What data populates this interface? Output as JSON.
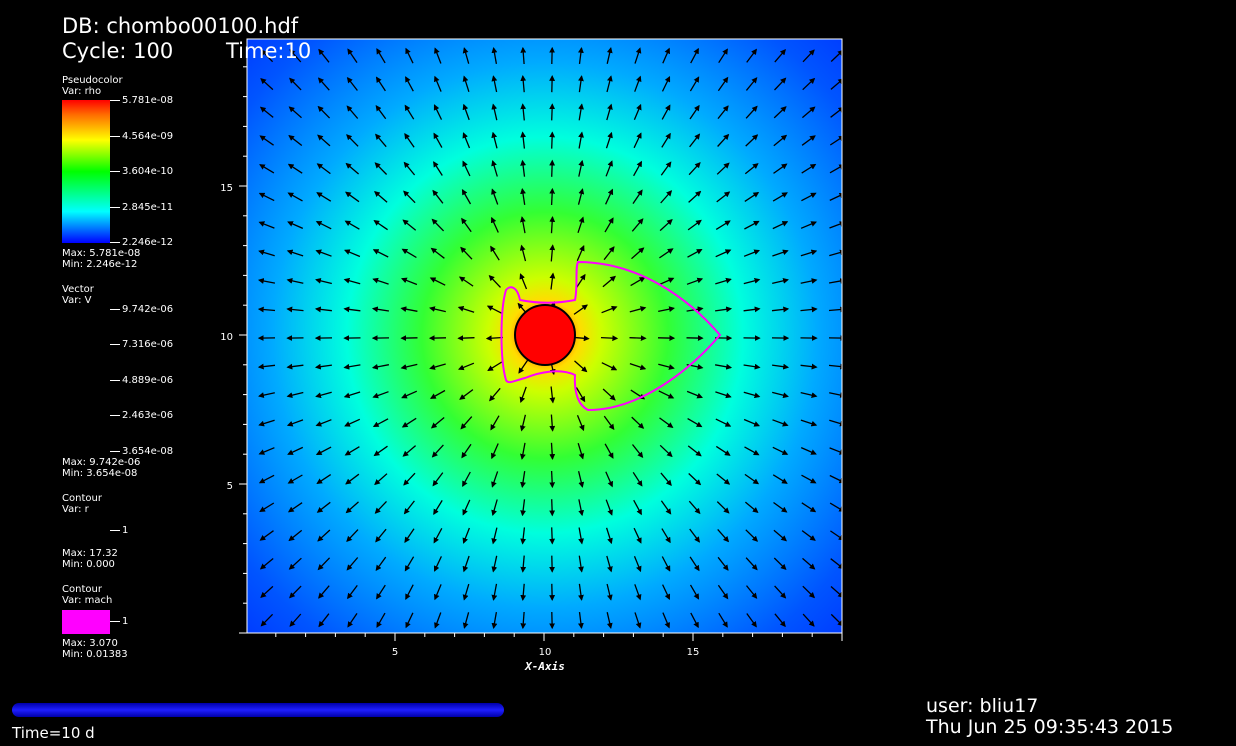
{
  "header": {
    "db": "DB: chombo00100.hdf",
    "cycle": "Cycle: 100",
    "time": "Time:10"
  },
  "legend": {
    "pseudocolor": {
      "title": "Pseudocolor",
      "var": "Var: rho",
      "ticks": [
        "5.781e-08",
        "4.564e-09",
        "3.604e-10",
        "2.845e-11",
        "2.246e-12"
      ],
      "max": "Max:  5.781e-08",
      "min": "Min:  2.246e-12"
    },
    "vector": {
      "title": "Vector",
      "var": "Var: V",
      "ticks": [
        "9.742e-06",
        "7.316e-06",
        "4.889e-06",
        "2.463e-06",
        "3.654e-08"
      ],
      "max": "Max:  9.742e-06",
      "min": "Min:  3.654e-08"
    },
    "contour_r": {
      "title": "Contour",
      "var": "Var: r",
      "tick": "1",
      "max": "Max:  17.32",
      "min": "Min:  0.000"
    },
    "contour_mach": {
      "title": "Contour",
      "var": "Var: mach",
      "tick": "1",
      "max": "Max:  3.070",
      "min": "Min:  0.01383",
      "swatch_color": "#ff00ff"
    }
  },
  "plot": {
    "xlabel": "X-Axis",
    "xticks": [
      "5",
      "10",
      "15"
    ],
    "yticks": [
      "15",
      "10",
      "5"
    ],
    "colormap": [
      "#0000ff",
      "#00ffff",
      "#00ff00",
      "#ffff00",
      "#ff0000"
    ],
    "contour_color": "#ff00ff"
  },
  "footer": {
    "time_slider_label": "Time=10 d",
    "user": "user: bliu17",
    "date": "Thu Jun 25 09:35:43 2015"
  }
}
